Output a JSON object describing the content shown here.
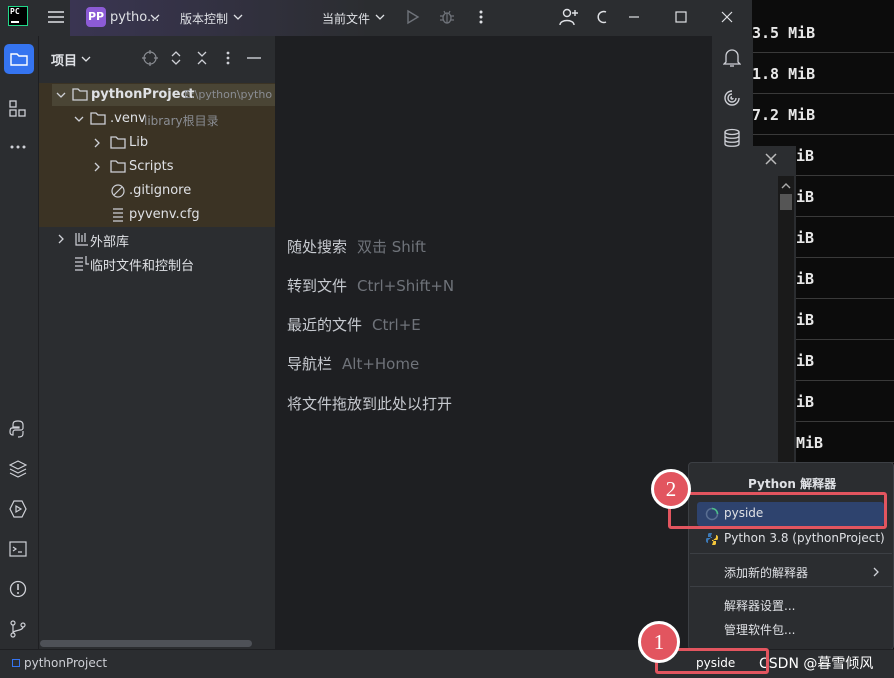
{
  "titlebar": {
    "app_logo_text": "PC",
    "project_badge": "PP",
    "project_name": "pytho...",
    "vcs_label": "版本控制",
    "run_config_label": "当前文件"
  },
  "project_panel": {
    "title": "项目",
    "tree": [
      {
        "label": "pythonProject",
        "hint": "E:\\python\\pytho"
      },
      {
        "label": ".venv",
        "hint": "library根目录"
      },
      {
        "label": "Lib"
      },
      {
        "label": "Scripts"
      },
      {
        "label": ".gitignore"
      },
      {
        "label": "pyvenv.cfg"
      },
      {
        "label": "外部库"
      },
      {
        "label": "临时文件和控制台"
      }
    ]
  },
  "editor_hints": [
    {
      "label": "随处搜索",
      "key": "双击 Shift"
    },
    {
      "label": "转到文件",
      "key": "Ctrl+Shift+N"
    },
    {
      "label": "最近的文件",
      "key": "Ctrl+E"
    },
    {
      "label": "导航栏",
      "key": "Alt+Home"
    },
    {
      "label": "将文件拖放到此处以打开",
      "key": ""
    }
  ],
  "terminal": {
    "rows": [
      "3.5 MiB",
      "1.8 MiB",
      "7.2 MiB",
      "iB",
      "iB",
      "iB",
      "iB",
      "iB",
      "iB",
      "iB",
      "MiB"
    ]
  },
  "popup": {
    "title": "Python 解释器",
    "items": [
      {
        "label": "pyside"
      },
      {
        "label": "Python 3.8 (pythonProject)"
      },
      {
        "label": "添加新的解释器"
      },
      {
        "label": "解释器设置..."
      },
      {
        "label": "管理软件包..."
      }
    ]
  },
  "statusbar": {
    "project": "pythonProject",
    "interpreter": "pyside"
  },
  "annotations": {
    "marker1": "1",
    "marker2": "2",
    "watermark": "CSDN @暮雪倾风"
  },
  "colors": {
    "accent": "#3574f0",
    "highlight_red": "#e2555f",
    "selection": "#2e436e"
  }
}
